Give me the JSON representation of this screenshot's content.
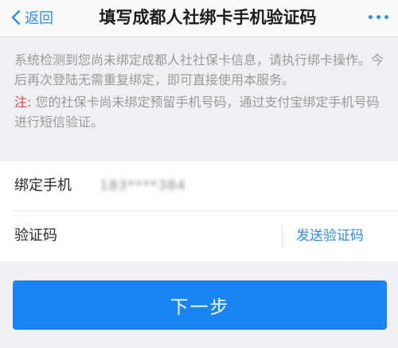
{
  "nav": {
    "back_label": "返回",
    "title": "填写成都人社绑卡手机验证码"
  },
  "notice": {
    "info": "系统检测到您尚未绑定成都人社社保卡信息，请执行绑卡操作。今后再次登陆无需重复绑定，即可直接使用本服务。",
    "warning_label": "注:",
    "warning_text": " 您的社保卡尚未绑定预留手机号码，通过支付宝绑定手机号码进行短信验证。"
  },
  "form": {
    "phone_label": "绑定手机",
    "phone_value": "183****3841",
    "code_label": "验证码",
    "send_code_label": "发送验证码"
  },
  "next_button_label": "下一步",
  "colors": {
    "accent": "#2b8ef0",
    "button": "#1a84f2",
    "warning": "#e8413e",
    "background": "#eef0f3"
  },
  "icons": {
    "back": "chevron-left-icon",
    "more": "more-dots-icon"
  }
}
